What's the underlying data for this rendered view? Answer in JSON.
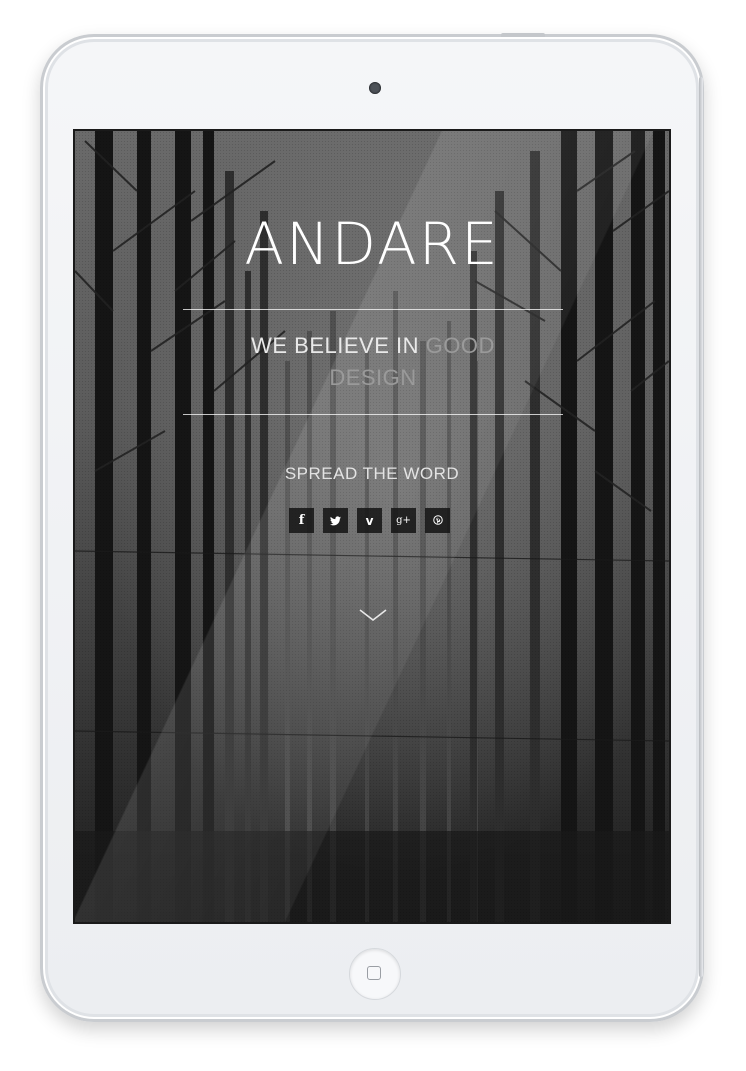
{
  "hero": {
    "brand": "ANDARE",
    "tagline_main": "WE BELIEVE IN ",
    "tagline_accent_1": "GOOD",
    "tagline_accent_2": "DESIGN",
    "spread": "SPREAD THE WORD"
  },
  "social": [
    {
      "name": "facebook",
      "icon": "facebook-icon",
      "glyph": "f"
    },
    {
      "name": "twitter",
      "icon": "twitter-icon",
      "glyph": ""
    },
    {
      "name": "vimeo",
      "icon": "vimeo-icon",
      "glyph": "v"
    },
    {
      "name": "google-plus",
      "icon": "google-plus-icon",
      "glyph": "g+"
    },
    {
      "name": "pinterest",
      "icon": "pinterest-icon",
      "glyph": ""
    }
  ],
  "scroll": {
    "icon": "chevron-down-icon"
  },
  "colors": {
    "accent_text": "#9a9a9a",
    "primary_text": "#ffffff",
    "social_bg": "#141414",
    "device_frame": "#f0f1f3"
  }
}
